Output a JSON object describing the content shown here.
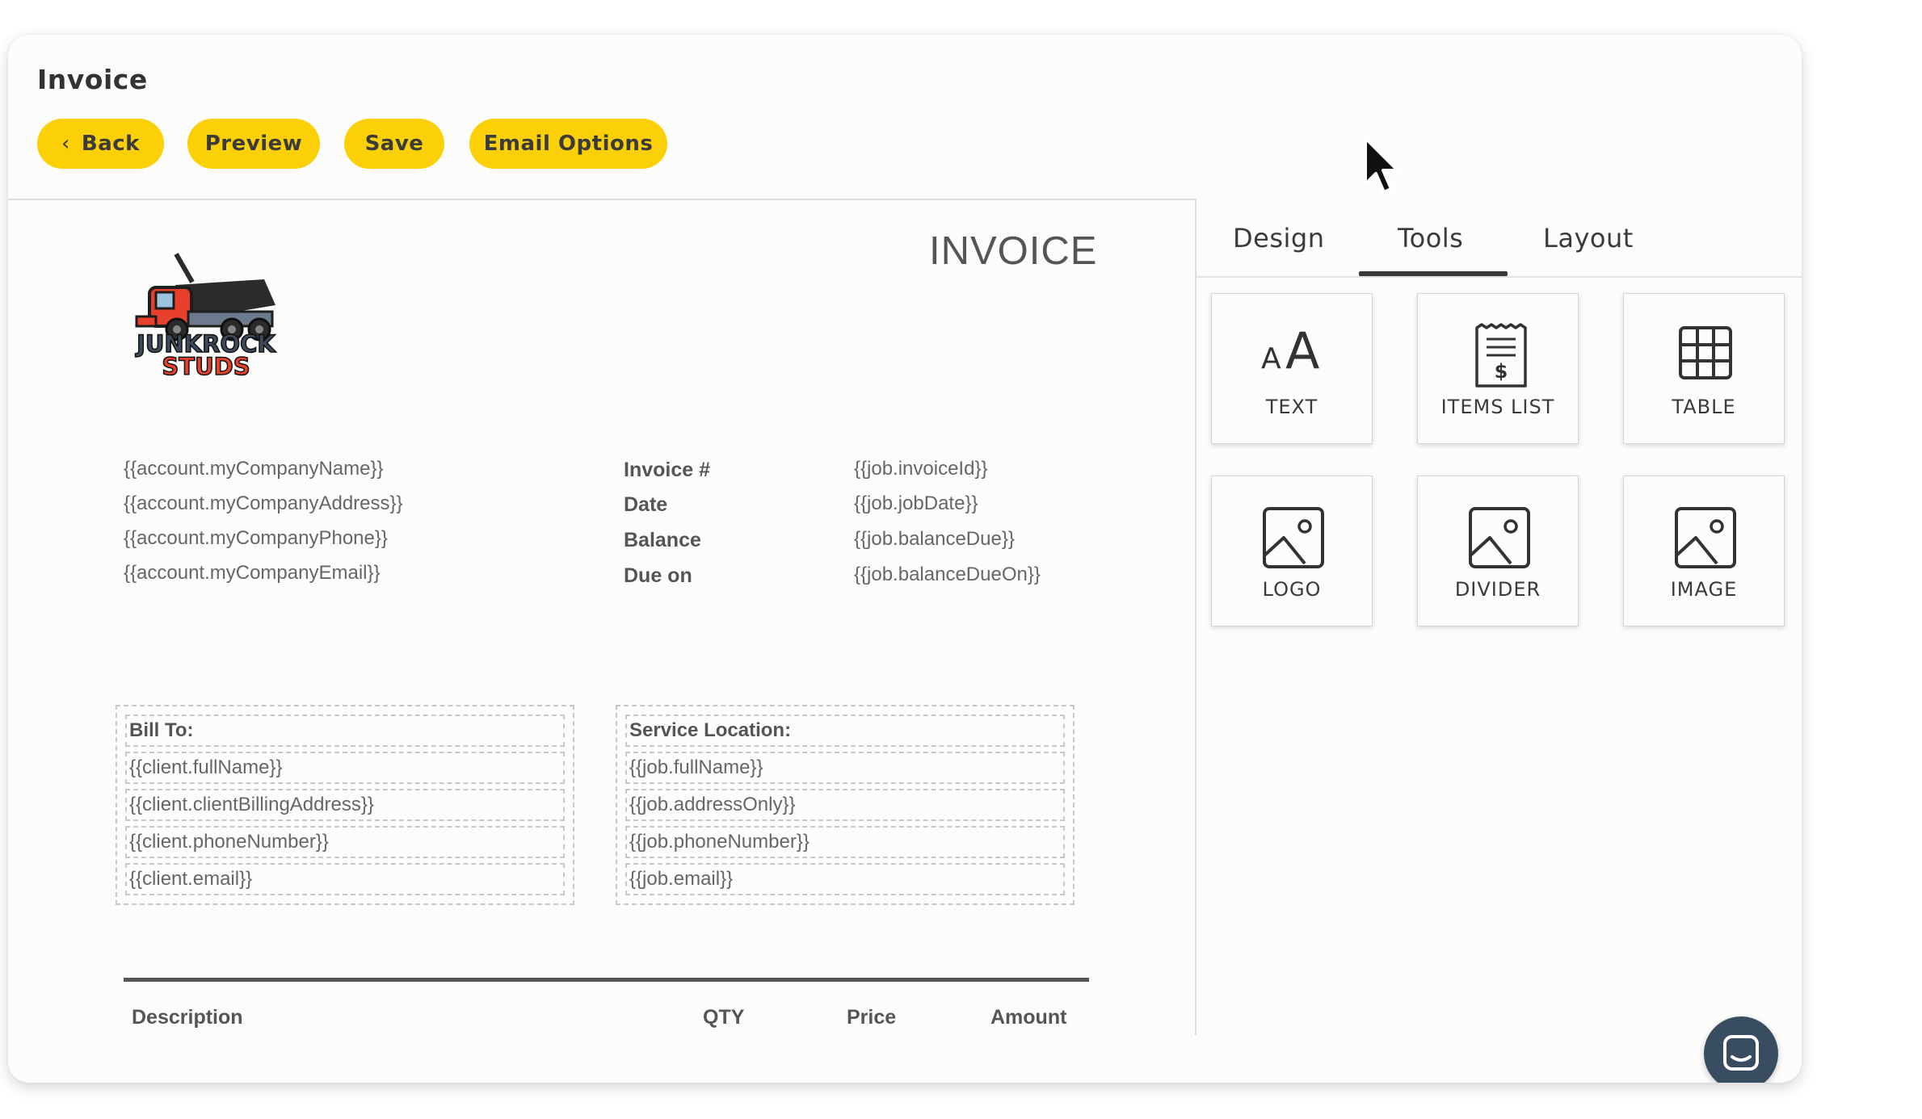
{
  "header": {
    "title": "Invoice"
  },
  "toolbar": {
    "back_label": "Back",
    "preview_label": "Preview",
    "save_label": "Save",
    "email_label": "Email Options"
  },
  "tabs": [
    {
      "label": "Design",
      "active": false
    },
    {
      "label": "Tools",
      "active": true
    },
    {
      "label": "Layout",
      "active": false
    }
  ],
  "tools": [
    {
      "label": "TEXT",
      "icon": "text-icon"
    },
    {
      "label": "ITEMS LIST",
      "icon": "receipt-icon"
    },
    {
      "label": "TABLE",
      "icon": "table-icon"
    },
    {
      "label": "LOGO",
      "icon": "image-icon"
    },
    {
      "label": "DIVIDER",
      "icon": "image-icon"
    },
    {
      "label": "IMAGE",
      "icon": "image-icon"
    }
  ],
  "invoice": {
    "heading": "INVOICE",
    "logo": {
      "line1": "JUNKROCK",
      "line2": "STUDS"
    },
    "company": [
      "{{account.myCompanyName}}",
      "{{account.myCompanyAddress}}",
      "{{account.myCompanyPhone}}",
      "{{account.myCompanyEmail}}"
    ],
    "meta": [
      {
        "label": "Invoice #",
        "value": "{{job.invoiceId}}"
      },
      {
        "label": "Date",
        "value": "{{job.jobDate}}"
      },
      {
        "label": "Balance",
        "value": "{{job.balanceDue}}"
      },
      {
        "label": "Due on",
        "value": "{{job.balanceDueOn}}"
      }
    ],
    "bill_to": {
      "heading": "Bill To:",
      "rows": [
        "{{client.fullName}}",
        "{{client.clientBillingAddress}}",
        "{{client.phoneNumber}}",
        "{{client.email}}"
      ]
    },
    "service_location": {
      "heading": "Service Location:",
      "rows": [
        "{{job.fullName}}",
        "{{job.addressOnly}}",
        "{{job.phoneNumber}}",
        "{{job.email}}"
      ]
    },
    "columns": [
      "Description",
      "QTY",
      "Price",
      "Amount"
    ]
  },
  "colors": {
    "accent": "#fcd006",
    "chat_bubble": "#384d60",
    "logo_red": "#e8402a"
  }
}
